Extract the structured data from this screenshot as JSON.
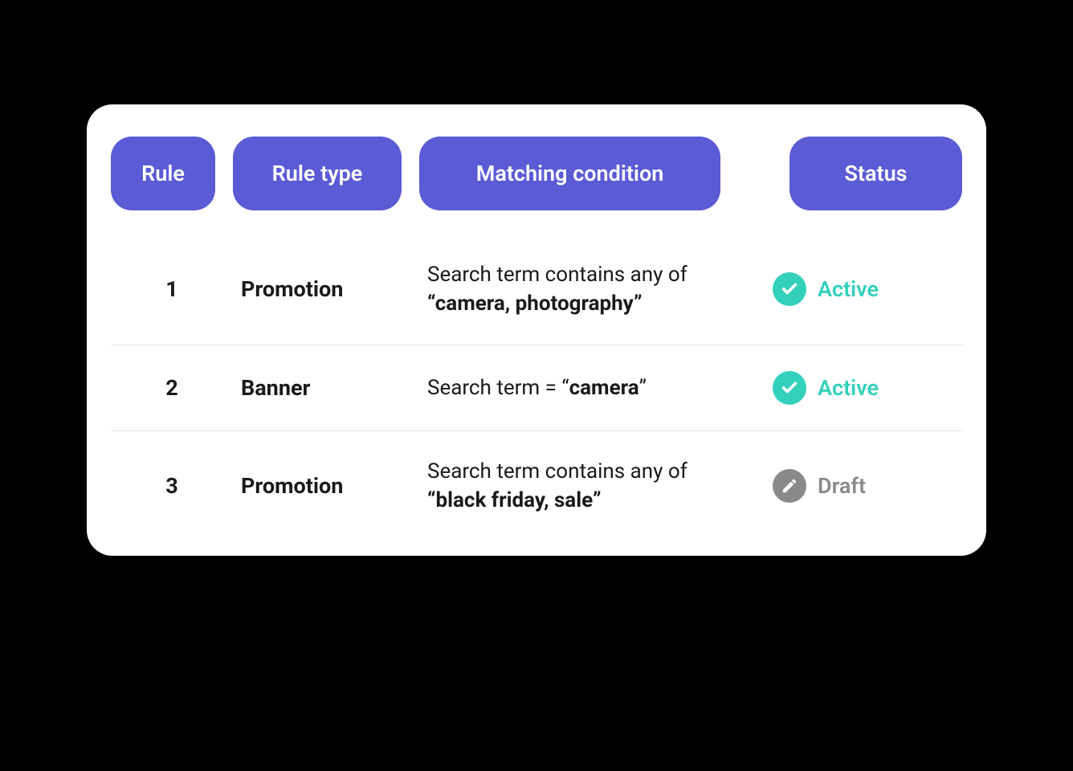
{
  "headers": {
    "rule": "Rule",
    "ruletype": "Rule type",
    "condition": "Matching condition",
    "status": "Status"
  },
  "rows": [
    {
      "id": "1",
      "ruletype": "Promotion",
      "condition_prefix": "Search term contains any of ",
      "condition_bold": "“camera, photography”",
      "status": "Active",
      "status_type": "active"
    },
    {
      "id": "2",
      "ruletype": "Banner",
      "condition_prefix": "Search term = “",
      "condition_bold": "camera",
      "condition_suffix": "”",
      "status": "Active",
      "status_type": "active"
    },
    {
      "id": "3",
      "ruletype": "Promotion",
      "condition_prefix": "Search term contains any of ",
      "condition_bold": "“black friday, sale”",
      "status": "Draft",
      "status_type": "draft"
    }
  ],
  "colors": {
    "header_bg": "#5b5bd6",
    "active": "#33d1bb",
    "draft": "#8a8a8a"
  }
}
